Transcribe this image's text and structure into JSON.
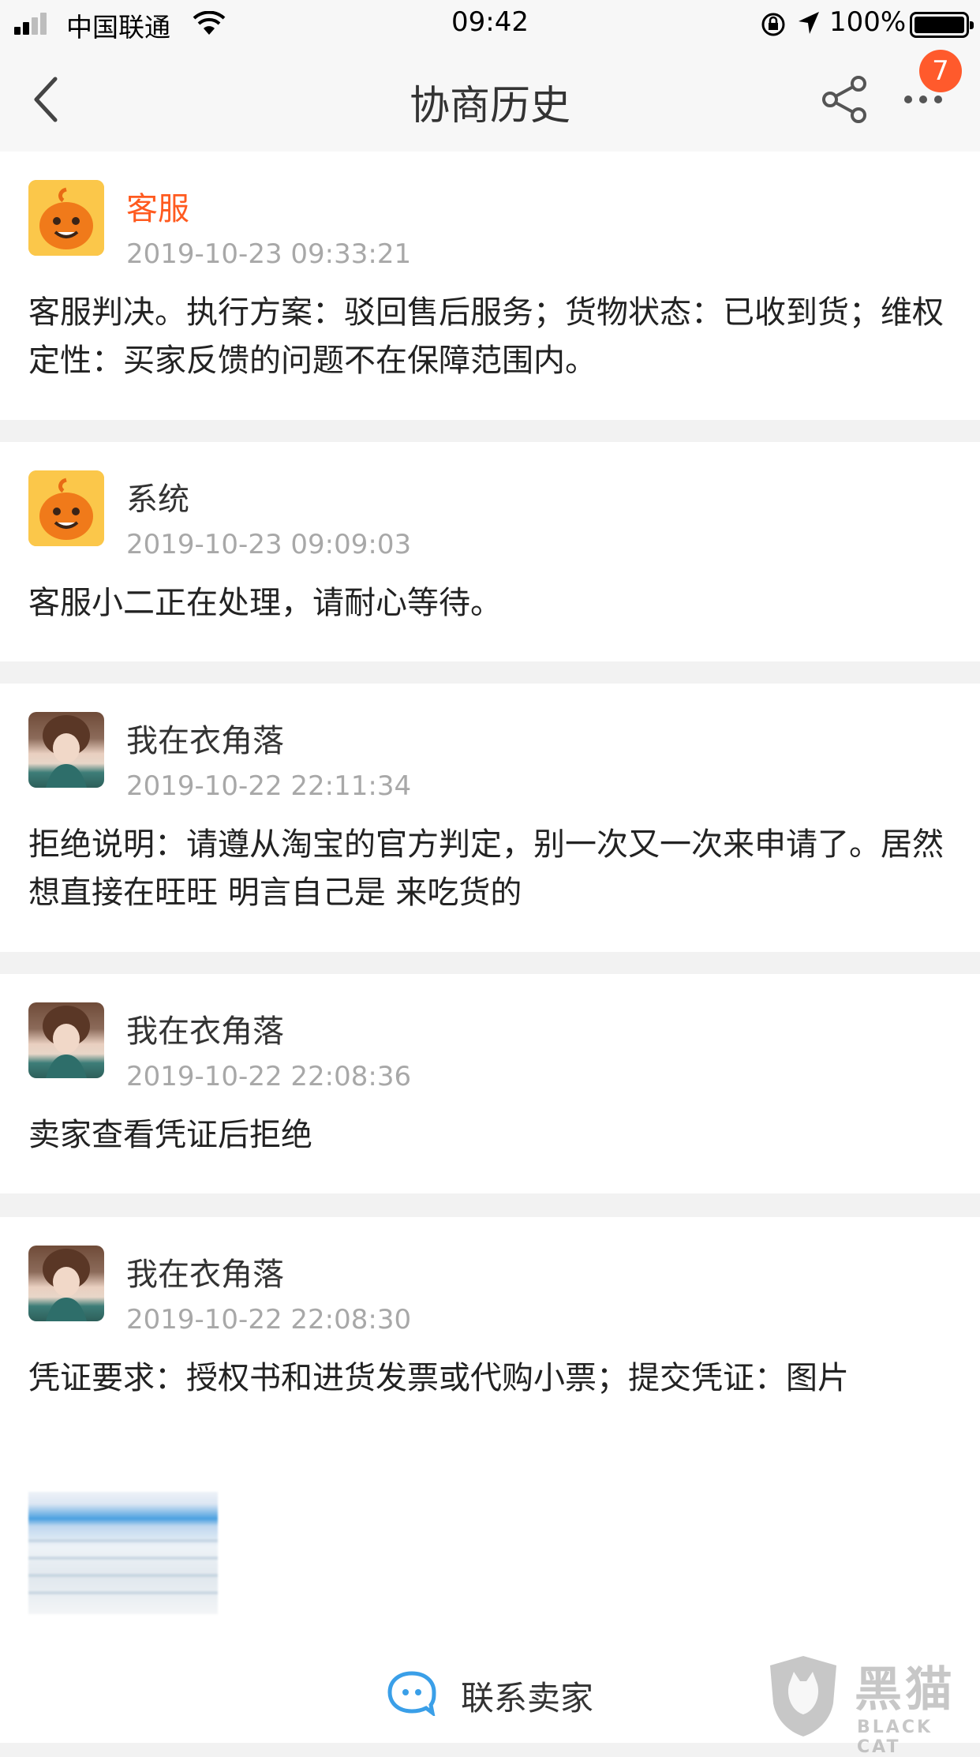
{
  "status_bar": {
    "carrier": "中国联通",
    "time": "09:42",
    "battery": "100%"
  },
  "nav": {
    "title": "协商历史",
    "badge_count": "7"
  },
  "entries": [
    {
      "sender": "客服",
      "timestamp": "2019-10-23 09:33:21",
      "message": "客服判决。执行方案：驳回售后服务；货物状态：已收到货；维权定性：买家反馈的问题不在保障范围内。"
    },
    {
      "sender": "系统",
      "timestamp": "2019-10-23 09:09:03",
      "message": "客服小二正在处理，请耐心等待。"
    },
    {
      "sender": "我在衣角落",
      "timestamp": "2019-10-22 22:11:34",
      "message": "拒绝说明：请遵从淘宝的官方判定，别一次又一次来申请了。居然想直接在旺旺  明言自己是  来吃货的"
    },
    {
      "sender": "我在衣角落",
      "timestamp": "2019-10-22 22:08:36",
      "message": "卖家查看凭证后拒绝"
    },
    {
      "sender": "我在衣角落",
      "timestamp": "2019-10-22 22:08:30",
      "message": "凭证要求：授权书和进货发票或代购小票；提交凭证：图片"
    }
  ],
  "bottom": {
    "contact_label": "联系卖家"
  },
  "watermark": {
    "cn": "黑猫",
    "en": "BLACK CAT"
  },
  "colors": {
    "accent_orange": "#ff5a1f",
    "badge": "#ff5a2c",
    "contact_icon": "#3a9fe8"
  }
}
